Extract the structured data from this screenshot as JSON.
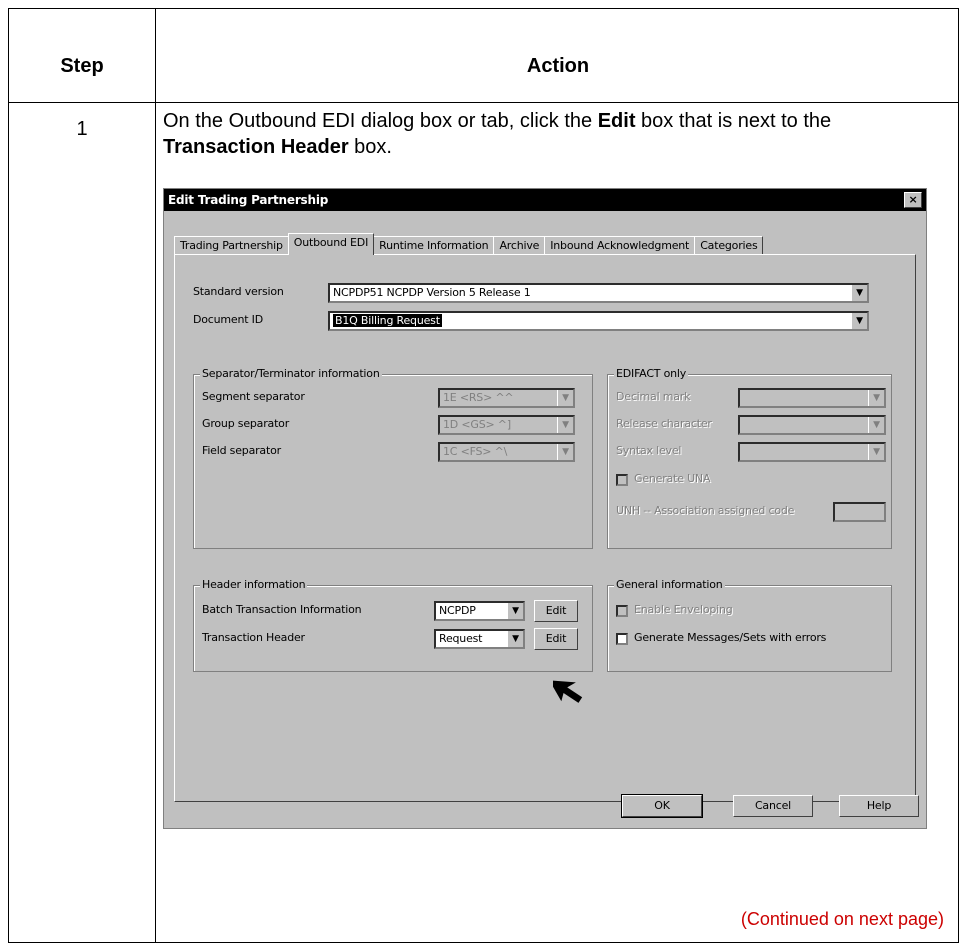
{
  "table": {
    "header_step": "Step",
    "header_action": "Action",
    "step_number": "1",
    "instruction": {
      "part1": "On the Outbound EDI dialog box or tab, click the ",
      "bold1": "Edit",
      "part2": " box that is next to the ",
      "bold2": "Transaction Header",
      "part3": " box."
    },
    "continued": "(Continued on next page)",
    "continued_color": "#cc0000"
  },
  "dialog": {
    "title": "Edit Trading Partnership",
    "close_label": "×",
    "tabs": [
      {
        "label": "Trading Partnership",
        "active": false
      },
      {
        "label": "Outbound EDI",
        "active": true
      },
      {
        "label": "Runtime Information",
        "active": false
      },
      {
        "label": "Archive",
        "active": false
      },
      {
        "label": "Inbound Acknowledgment",
        "active": false
      },
      {
        "label": "Categories",
        "active": false
      }
    ],
    "standard_version": {
      "label": "Standard version",
      "value": "NCPDP51   NCPDP Version 5 Release 1"
    },
    "document_id": {
      "label": "Document ID",
      "value": "B1Q   Billing Request"
    },
    "separator_group": {
      "title": "Separator/Terminator information",
      "segment": {
        "label": "Segment separator",
        "value": "1E <RS> ^^"
      },
      "group": {
        "label": "Group separator",
        "value": "1D <GS> ^]"
      },
      "field": {
        "label": "Field separator",
        "value": "1C <FS> ^\\"
      }
    },
    "edifact_group": {
      "title": "EDIFACT only",
      "decimal_mark": "Decimal mark",
      "release_char": "Release character",
      "syntax_level": "Syntax level",
      "generate_una": "Generate UNA",
      "unh": "UNH -- Association assigned code"
    },
    "header_group": {
      "title": "Header information",
      "batch": {
        "label": "Batch Transaction Information",
        "value": "NCPDP",
        "edit": "Edit"
      },
      "transaction": {
        "label": "Transaction Header",
        "value": "Request",
        "edit": "Edit"
      }
    },
    "general_group": {
      "title": "General information",
      "enveloping": "Enable Enveloping",
      "generate_errors": "Generate Messages/Sets with errors"
    },
    "buttons": {
      "ok": "OK",
      "cancel": "Cancel",
      "help": "Help"
    },
    "arrow_icon": "mouse-pointer-icon"
  }
}
